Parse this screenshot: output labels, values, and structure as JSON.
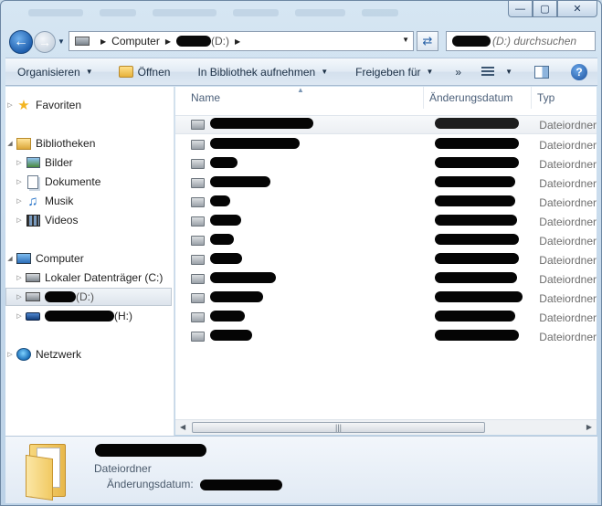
{
  "window": {
    "minimize": "—",
    "maximize": "▢",
    "close": "✕"
  },
  "address": {
    "crumbs": [
      "Computer",
      "(D:)"
    ],
    "search_placeholder": "(D:) durchsuchen"
  },
  "toolbar": {
    "organize": "Organisieren",
    "open": "Öffnen",
    "library": "In Bibliothek aufnehmen",
    "share": "Freigeben für",
    "more": "»",
    "help": "?"
  },
  "nav": {
    "favorites": "Favoriten",
    "libraries": "Bibliotheken",
    "pictures": "Bilder",
    "documents": "Dokumente",
    "music": "Musik",
    "videos": "Videos",
    "computer": "Computer",
    "local_disk": "Lokaler Datenträger (C:)",
    "drive_d": "(D:)",
    "drive_h": "(H:)",
    "network": "Netzwerk"
  },
  "columns": {
    "name": "Name",
    "date": "Änderungsdatum",
    "type": "Typ"
  },
  "files": [
    {
      "type": "Dateiordner"
    },
    {
      "type": "Dateiordner"
    },
    {
      "type": "Dateiordner"
    },
    {
      "type": "Dateiordner"
    },
    {
      "type": "Dateiordner"
    },
    {
      "type": "Dateiordner"
    },
    {
      "type": "Dateiordner"
    },
    {
      "type": "Dateiordner"
    },
    {
      "type": "Dateiordner"
    },
    {
      "type": "Dateiordner"
    },
    {
      "type": "Dateiordner"
    },
    {
      "type": "Dateiordner"
    }
  ],
  "details": {
    "type": "Dateiordner",
    "modified_label": "Änderungsdatum:"
  }
}
